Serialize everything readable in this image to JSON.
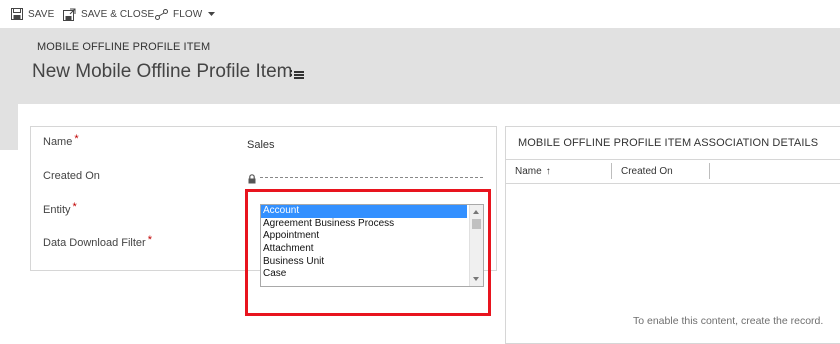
{
  "toolbar": {
    "save_label": "SAVE",
    "save_close_label": "SAVE & CLOSE",
    "flow_label": "FLOW"
  },
  "header": {
    "entity_name": "MOBILE OFFLINE PROFILE ITEM",
    "title": "New Mobile Offline Profile Item"
  },
  "form": {
    "fields": {
      "name": {
        "label": "Name",
        "required": "*",
        "value": "Sales"
      },
      "created_on": {
        "label": "Created On"
      },
      "entity": {
        "label": "Entity",
        "required": "*"
      },
      "data_download_filter": {
        "label": "Data Download Filter",
        "required": "*"
      }
    },
    "entity_options": [
      "Account",
      "Agreement Business Process",
      "Appointment",
      "Attachment",
      "Business Unit",
      "Case"
    ],
    "entity_selected": "Account"
  },
  "association_panel": {
    "title": "MOBILE OFFLINE PROFILE ITEM ASSOCIATION DETAILS",
    "columns": [
      "Name",
      "Created On"
    ],
    "sort_indicator": "↑",
    "empty_message": "To enable this content, create the record."
  },
  "colors": {
    "header_bg": "#e1e1e1",
    "required": "#c00000",
    "highlight": "#e8141e",
    "selection": "#3390ff"
  }
}
